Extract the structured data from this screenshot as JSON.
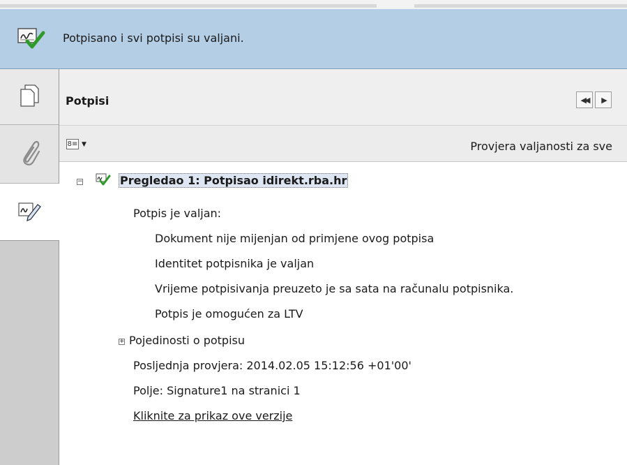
{
  "banner": {
    "icon": "signature-valid-icon",
    "message": "Potpisano i svi potpisi su valjani."
  },
  "sidebar": {
    "tabs": [
      {
        "icon": "pages-icon"
      },
      {
        "icon": "paperclip-icon"
      },
      {
        "icon": "signature-pen-icon"
      }
    ]
  },
  "panel": {
    "title": "Potpisi",
    "options_icon": "options-list-icon",
    "validate_all_label": "Provjera valjanosti za sve"
  },
  "signature": {
    "title": "Pregledao 1: Potpisao idirekt.rba.hr",
    "status_label": "Potpis je valjan:",
    "details": [
      "Dokument nije mijenjan od primjene ovog potpisa",
      "Identitet potpisnika je valjan",
      "Vrijeme potpisivanja preuzeto je sa sata na računalu potpisnika.",
      "Potpis je omogućen za LTV"
    ],
    "properties_label": "Pojedinosti o potpisu",
    "last_check": "Posljednja provjera: 2014.02.05 15:12:56 +01'00'",
    "field": "Polje: Signature1 na stranici 1",
    "view_version_link": "Kliknite za prikaz ove verzije"
  },
  "colors": {
    "banner_bg": "#b4cee5",
    "valid_green": "#3aa830",
    "selection_bg": "#dde6f2"
  }
}
